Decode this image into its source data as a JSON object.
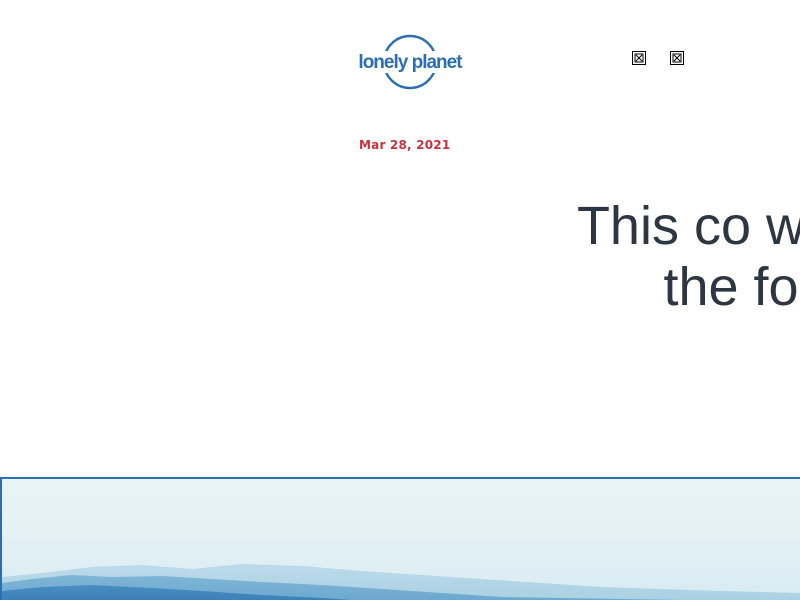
{
  "header": {
    "logo_text": "lonely planet",
    "logo_icon": "lonely-planet-logo",
    "broken_images": [
      "broken-image-icon",
      "broken-image-icon"
    ]
  },
  "article": {
    "date": "Mar 28, 2021",
    "headline": "This co world’s the four"
  },
  "hero": {
    "image": "misty-blue-mountains"
  },
  "colors": {
    "brand_blue": "#2a6fb4",
    "date_red": "#c8323c",
    "headline_text": "#2e3642"
  }
}
